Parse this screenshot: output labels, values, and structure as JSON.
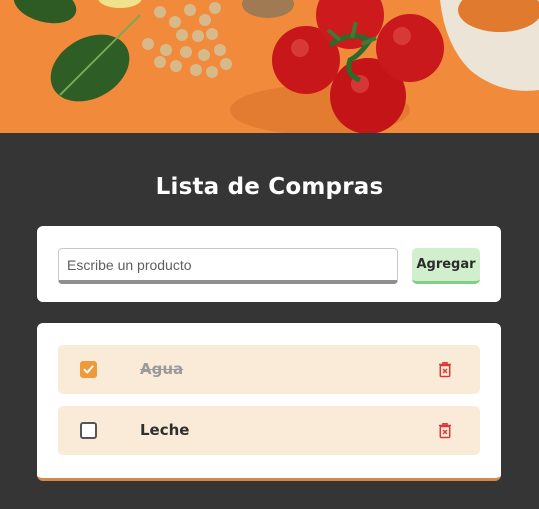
{
  "app": {
    "title": "Lista de Compras"
  },
  "form": {
    "input_value": "",
    "input_placeholder": "Escribe un producto",
    "add_label": "Agregar"
  },
  "items": [
    {
      "label": "Agua",
      "checked": true
    },
    {
      "label": "Leche",
      "checked": false
    }
  ],
  "icons": {
    "delete": "trash-icon",
    "check": "checkmark-icon"
  },
  "colors": {
    "background": "#353535",
    "banner": "#f28a3c",
    "item_bg": "#faebd8",
    "checkbox_accent": "#ef9a3a",
    "add_button": "#d2efcd",
    "delete_icon": "#d83a3a"
  }
}
